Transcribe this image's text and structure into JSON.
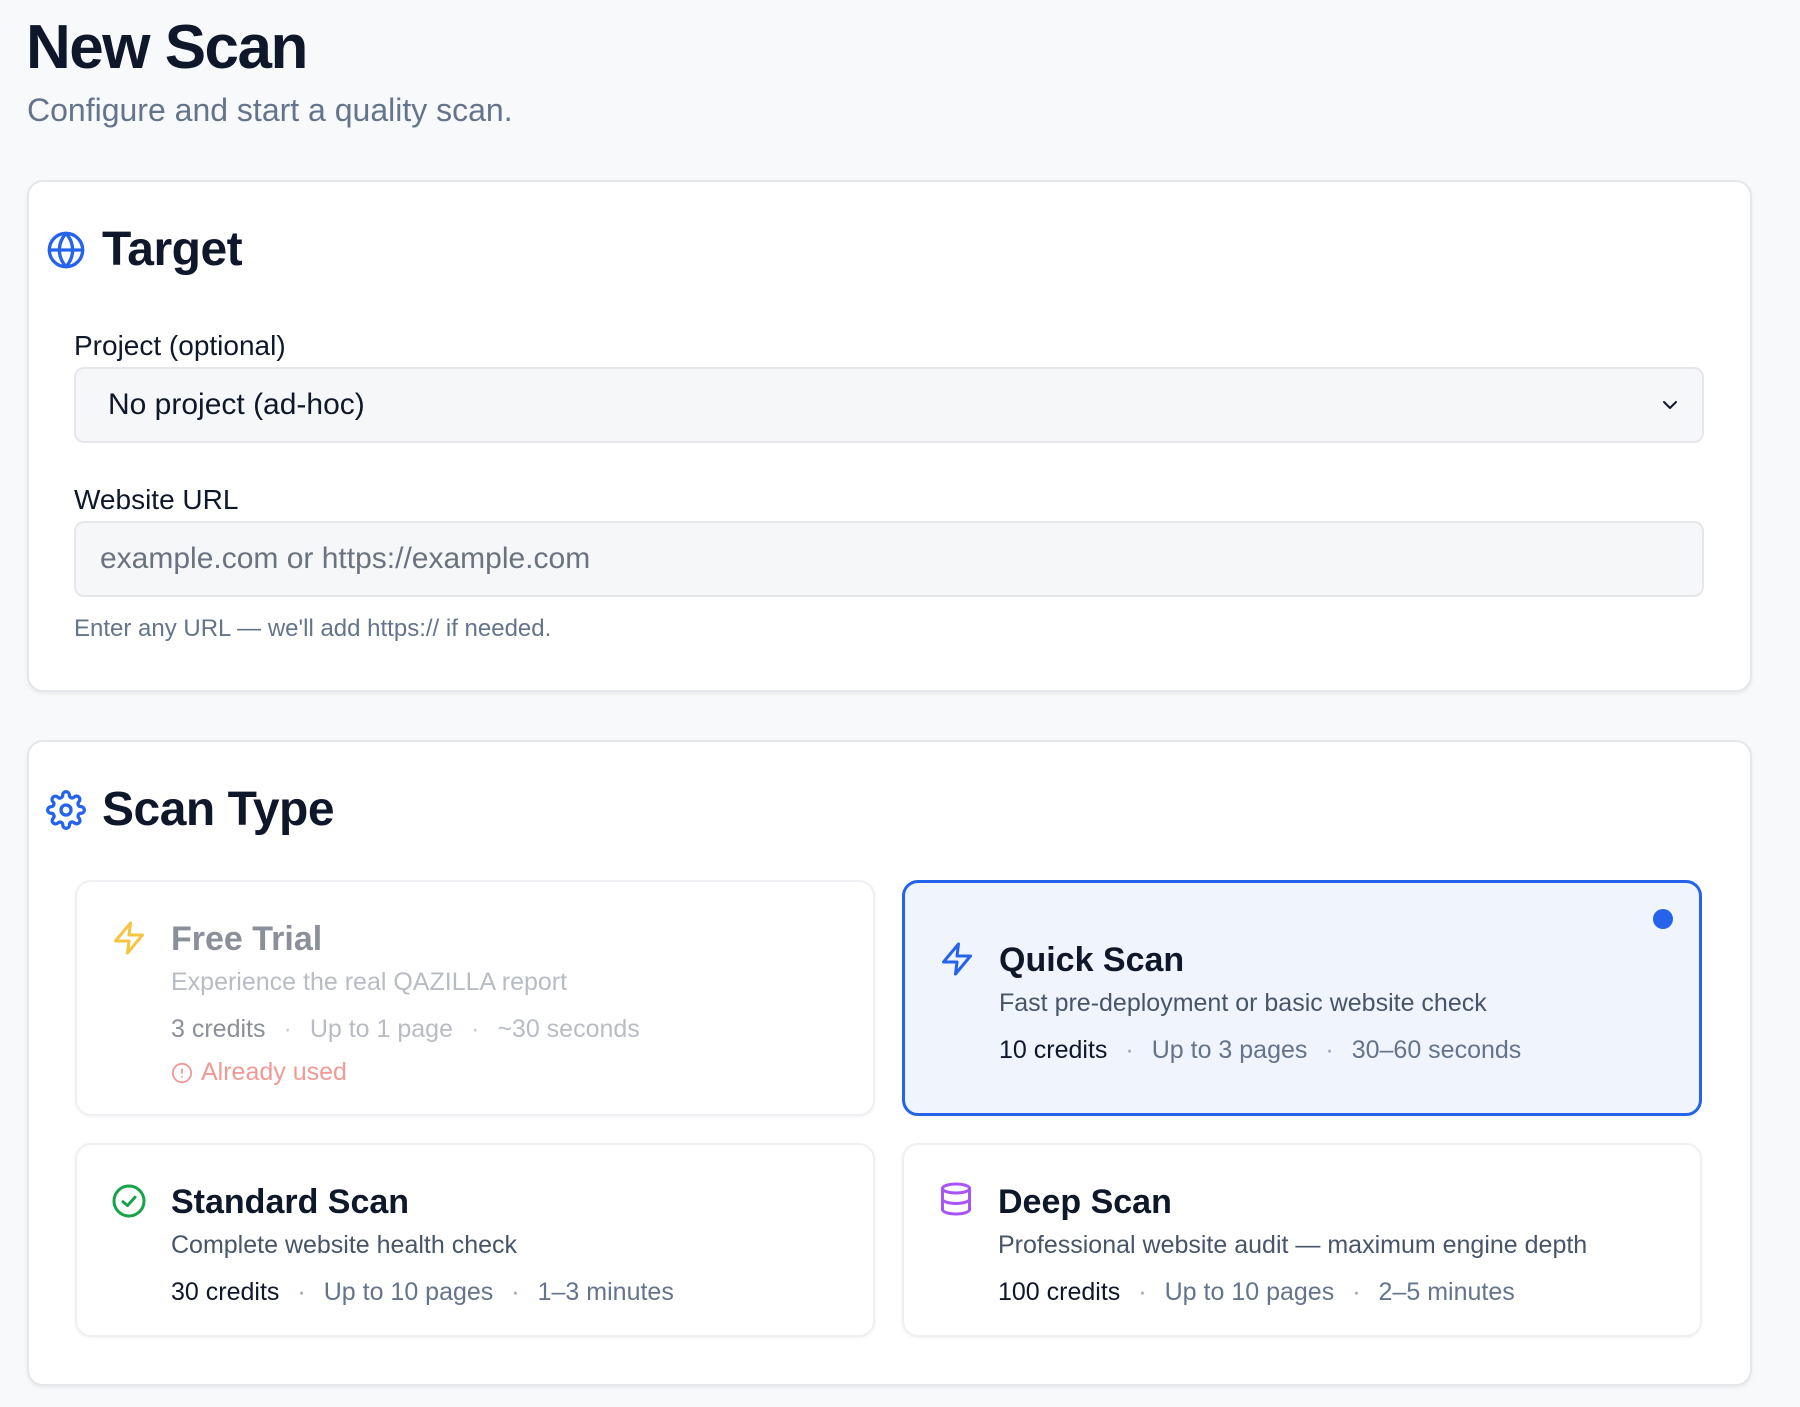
{
  "header": {
    "title": "New Scan",
    "subtitle": "Configure and start a quality scan."
  },
  "target": {
    "section_title": "Target",
    "project_label": "Project (optional)",
    "project_selected": "No project (ad-hoc)",
    "url_label": "Website URL",
    "url_value": "",
    "url_placeholder": "example.com or https://example.com",
    "url_hint": "Enter any URL — we'll add https:// if needed."
  },
  "scan_type": {
    "section_title": "Scan Type",
    "options": [
      {
        "name": "Free Trial",
        "description": "Experience the real QAZILLA report",
        "credits": "3 credits",
        "pages": "Up to 1 page",
        "duration": "~30 seconds",
        "status": "Already used",
        "icon": "zap-icon",
        "state": "disabled"
      },
      {
        "name": "Quick Scan",
        "description": "Fast pre-deployment or basic website check",
        "credits": "10 credits",
        "pages": "Up to 3 pages",
        "duration": "30–60 seconds",
        "icon": "zap-icon",
        "state": "selected"
      },
      {
        "name": "Standard Scan",
        "description": "Complete website health check",
        "credits": "30 credits",
        "pages": "Up to 10 pages",
        "duration": "1–3 minutes",
        "icon": "check-circle-icon",
        "state": "available"
      },
      {
        "name": "Deep Scan",
        "description": "Professional website audit — maximum engine depth",
        "credits": "100 credits",
        "pages": "Up to 10 pages",
        "duration": "2–5 minutes",
        "icon": "database-icon",
        "state": "available"
      }
    ]
  },
  "colors": {
    "accent": "#2563eb",
    "success": "#16a34a",
    "warning": "#f5c542",
    "deep": "#a855f7",
    "error": "#f09a95"
  }
}
